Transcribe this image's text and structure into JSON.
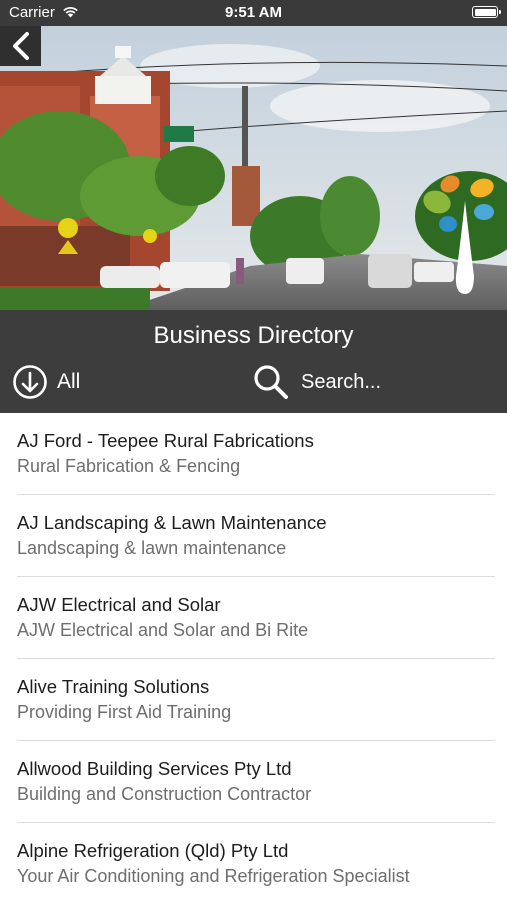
{
  "status_bar": {
    "carrier": "Carrier",
    "time": "9:51 AM"
  },
  "hero": {
    "image": "street-scene-photo",
    "logo": "leaf-tree-logo",
    "back_icon": "chevron-left-icon"
  },
  "header": {
    "title": "Business Directory",
    "filter_label": "All",
    "filter_icon": "arrow-down-circle-icon",
    "search_label": "Search...",
    "search_icon": "search-icon"
  },
  "colors": {
    "header_bg": "#3d3d3d",
    "status_bg": "#3a3a3a",
    "separator": "#dcdcdc",
    "subtitle": "#6e6e6e"
  },
  "businesses": [
    {
      "name": " AJ Ford - Teepee Rural Fabrications",
      "desc": "Rural Fabrication & Fencing"
    },
    {
      "name": "AJ Landscaping & Lawn Maintenance",
      "desc": "Landscaping & lawn maintenance"
    },
    {
      "name": "AJW Electrical and Solar",
      "desc": "AJW Electrical and Solar and Bi Rite"
    },
    {
      "name": "Alive Training Solutions",
      "desc": "Providing First Aid Training"
    },
    {
      "name": "Allwood Building Services Pty Ltd",
      "desc": "Building and Construction Contractor"
    },
    {
      "name": "Alpine Refrigeration (Qld) Pty Ltd",
      "desc": "Your Air Conditioning and Refrigeration Specialist"
    }
  ]
}
